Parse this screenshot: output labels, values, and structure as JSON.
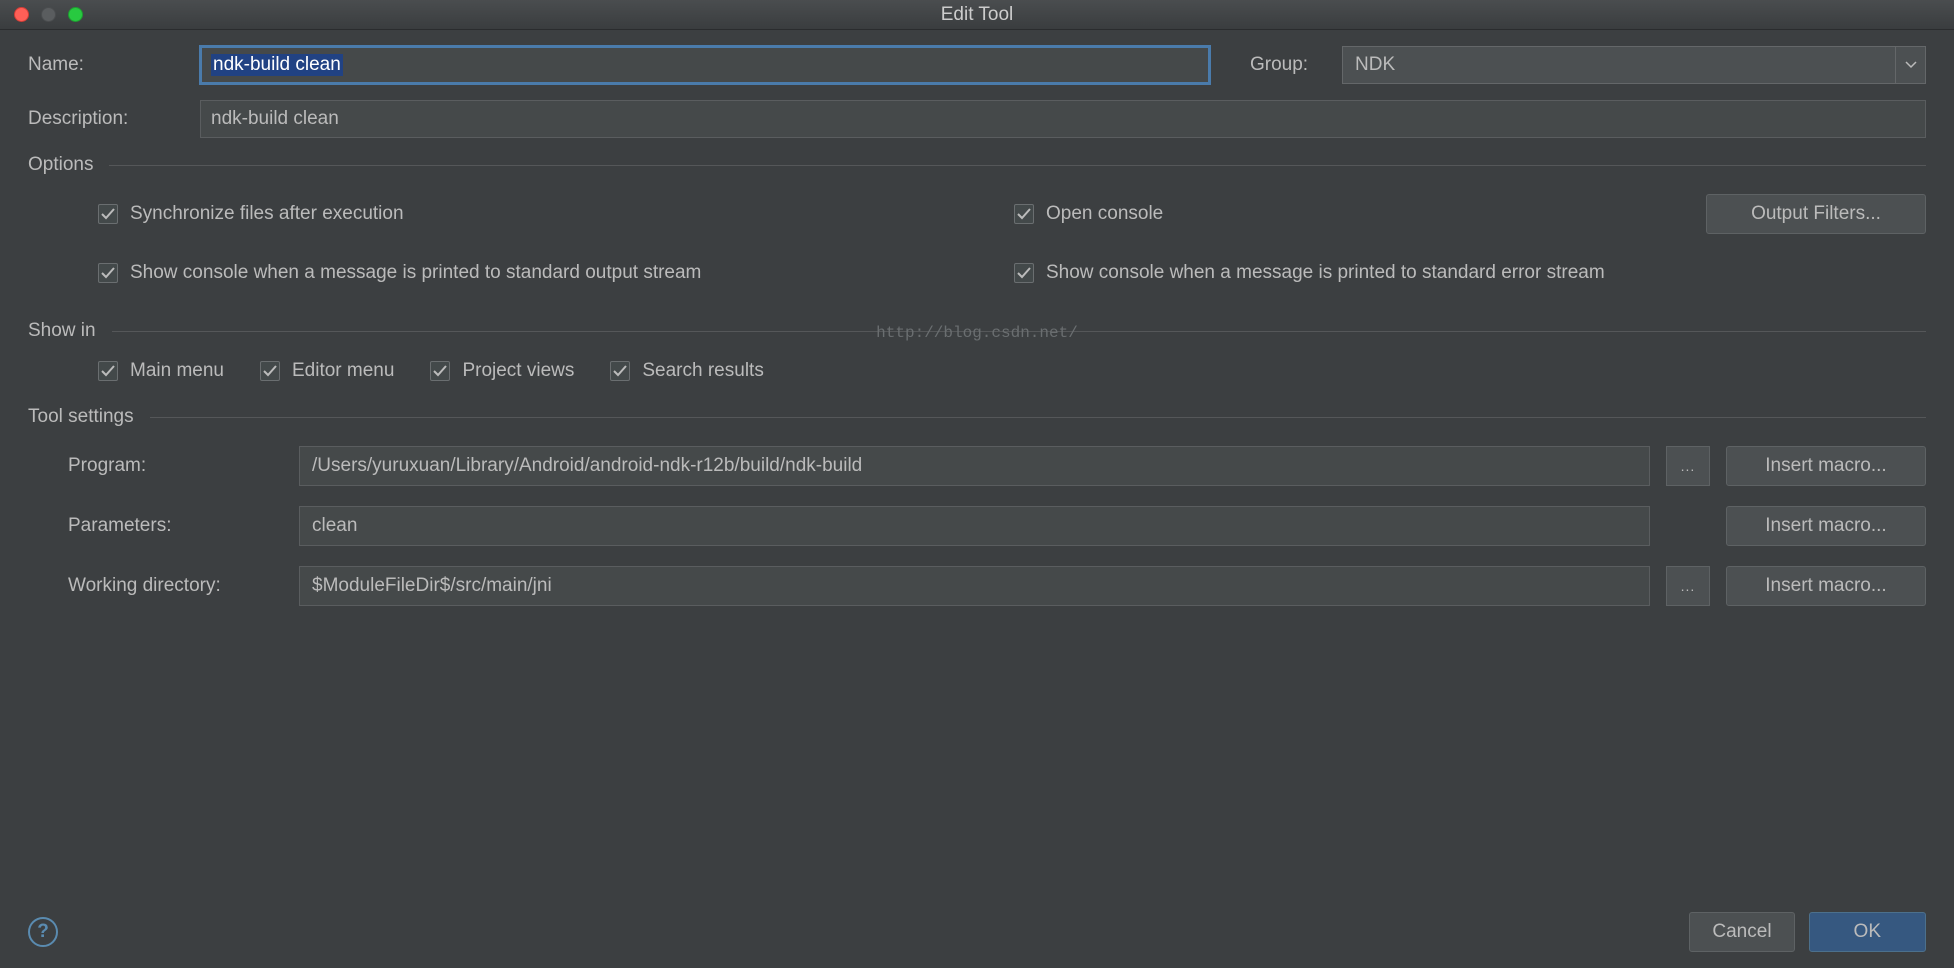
{
  "window": {
    "title": "Edit Tool"
  },
  "form": {
    "name_label": "Name:",
    "name_value": "ndk-build clean",
    "group_label": "Group:",
    "group_value": "NDK",
    "description_label": "Description:",
    "description_value": "ndk-build clean"
  },
  "sections": {
    "options": "Options",
    "show_in": "Show in",
    "tool_settings": "Tool settings"
  },
  "options": {
    "sync_files": "Synchronize files after execution",
    "open_console": "Open console",
    "output_filters": "Output Filters...",
    "show_stdout": "Show console when a message is printed to standard output stream",
    "show_stderr": "Show console when a message is printed to standard error stream"
  },
  "show_in": {
    "main_menu": "Main menu",
    "editor_menu": "Editor menu",
    "project_views": "Project views",
    "search_results": "Search results"
  },
  "tool": {
    "program_label": "Program:",
    "program_value": "/Users/yuruxuan/Library/Android/android-ndk-r12b/build/ndk-build",
    "parameters_label": "Parameters:",
    "parameters_value": "clean",
    "working_dir_label": "Working directory:",
    "working_dir_value": "$ModuleFileDir$/src/main/jni",
    "browse": "...",
    "insert_macro": "Insert macro..."
  },
  "watermark": "http://blog.csdn.net/",
  "footer": {
    "cancel": "Cancel",
    "ok": "OK",
    "help": "?"
  }
}
